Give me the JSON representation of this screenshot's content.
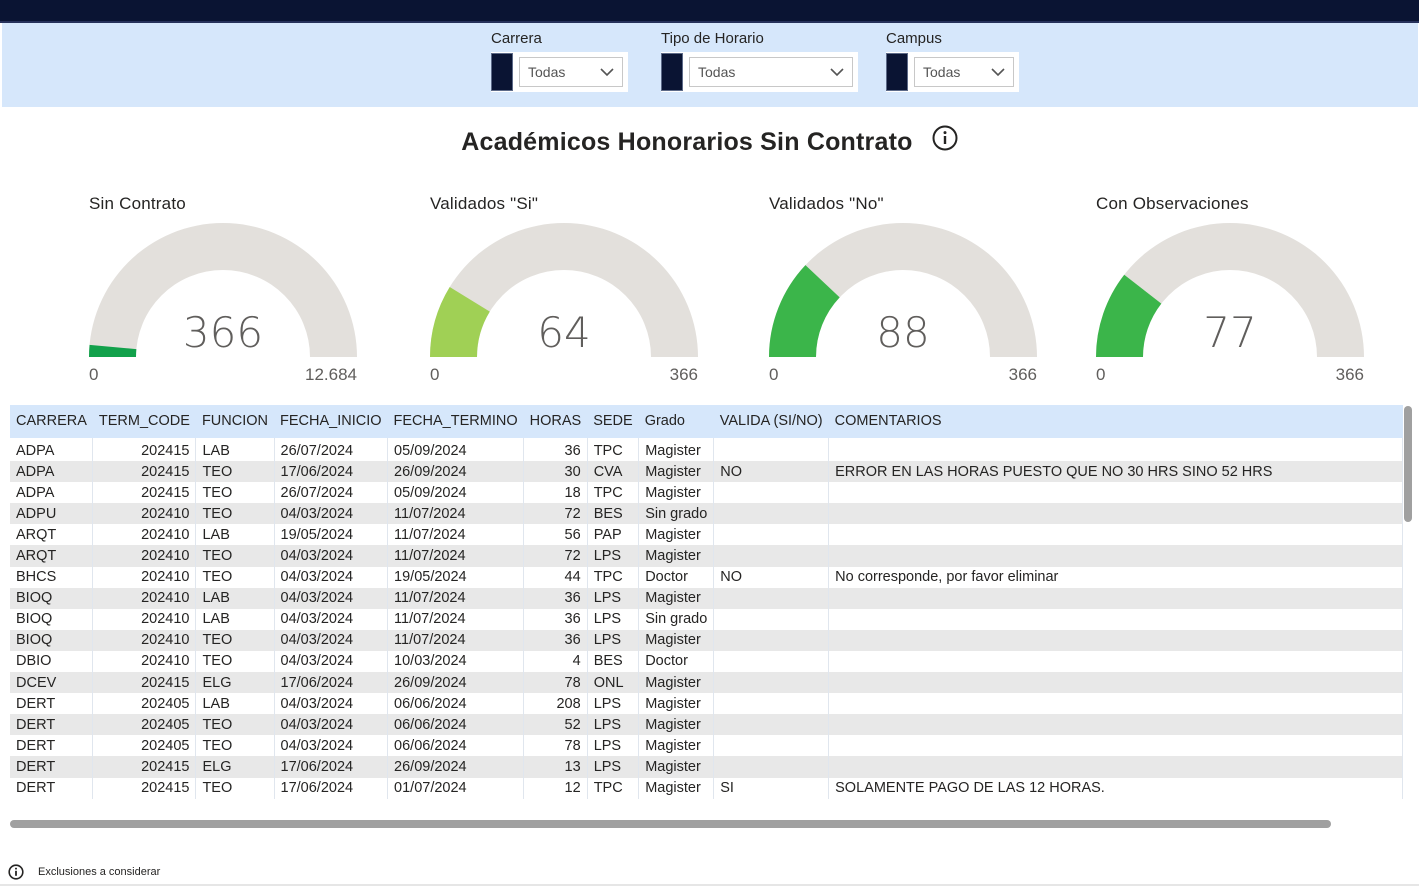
{
  "filters": [
    {
      "label": "Carrera",
      "value": "Todas"
    },
    {
      "label": "Tipo de Horario",
      "value": "Todas"
    },
    {
      "label": "Campus",
      "value": "Todas"
    }
  ],
  "title": "Académicos Honorarios Sin Contrato",
  "gauges": [
    {
      "title": "Sin Contrato",
      "value": "366",
      "min": "0",
      "max": "12.684",
      "fraction": 0.0289,
      "color": "#12a14b"
    },
    {
      "title": "Validados \"Si\"",
      "value": "64",
      "min": "0",
      "max": "366",
      "fraction": 0.1749,
      "color": "#a0d055"
    },
    {
      "title": "Validados \"No\"",
      "value": "88",
      "min": "0",
      "max": "366",
      "fraction": 0.2404,
      "color": "#3bb54a"
    },
    {
      "title": "Con Observaciones",
      "value": "77",
      "min": "0",
      "max": "366",
      "fraction": 0.2104,
      "color": "#3bb54a"
    }
  ],
  "table": {
    "columns": [
      "CARRERA",
      "TERM_CODE",
      "FUNCION",
      "FECHA_INICIO",
      "FECHA_TERMINO",
      "HORAS",
      "SEDE",
      "Grado",
      "VALIDA (SI/NO)",
      "COMENTARIOS"
    ],
    "rows": [
      [
        "ADPA",
        "202415",
        "LAB",
        "26/07/2024",
        "05/09/2024",
        "36",
        "TPC",
        "Magister",
        "",
        ""
      ],
      [
        "ADPA",
        "202415",
        "TEO",
        "17/06/2024",
        "26/09/2024",
        "30",
        "CVA",
        "Magister",
        "NO",
        "ERROR EN LAS HORAS PUESTO QUE NO 30 HRS SINO 52 HRS"
      ],
      [
        "ADPA",
        "202415",
        "TEO",
        "26/07/2024",
        "05/09/2024",
        "18",
        "TPC",
        "Magister",
        "",
        ""
      ],
      [
        "ADPU",
        "202410",
        "TEO",
        "04/03/2024",
        "11/07/2024",
        "72",
        "BES",
        "Sin grado",
        "",
        ""
      ],
      [
        "ARQT",
        "202410",
        "LAB",
        "19/05/2024",
        "11/07/2024",
        "56",
        "PAP",
        "Magister",
        "",
        ""
      ],
      [
        "ARQT",
        "202410",
        "TEO",
        "04/03/2024",
        "11/07/2024",
        "72",
        "LPS",
        "Magister",
        "",
        ""
      ],
      [
        "BHCS",
        "202410",
        "TEO",
        "04/03/2024",
        "19/05/2024",
        "44",
        "TPC",
        "Doctor",
        "NO",
        "No corresponde, por favor eliminar"
      ],
      [
        "BIOQ",
        "202410",
        "LAB",
        "04/03/2024",
        "11/07/2024",
        "36",
        "LPS",
        "Magister",
        "",
        ""
      ],
      [
        "BIOQ",
        "202410",
        "LAB",
        "04/03/2024",
        "11/07/2024",
        "36",
        "LPS",
        "Sin grado",
        "",
        ""
      ],
      [
        "BIOQ",
        "202410",
        "TEO",
        "04/03/2024",
        "11/07/2024",
        "36",
        "LPS",
        "Magister",
        "",
        ""
      ],
      [
        "DBIO",
        "202410",
        "TEO",
        "04/03/2024",
        "10/03/2024",
        "4",
        "BES",
        "Doctor",
        "",
        ""
      ],
      [
        "DCEV",
        "202415",
        "ELG",
        "17/06/2024",
        "26/09/2024",
        "78",
        "ONL",
        "Magister",
        "",
        ""
      ],
      [
        "DERT",
        "202405",
        "LAB",
        "04/03/2024",
        "06/06/2024",
        "208",
        "LPS",
        "Magister",
        "",
        ""
      ],
      [
        "DERT",
        "202405",
        "TEO",
        "04/03/2024",
        "06/06/2024",
        "52",
        "LPS",
        "Magister",
        "",
        ""
      ],
      [
        "DERT",
        "202405",
        "TEO",
        "04/03/2024",
        "06/06/2024",
        "78",
        "LPS",
        "Magister",
        "",
        ""
      ],
      [
        "DERT",
        "202415",
        "ELG",
        "17/06/2024",
        "26/09/2024",
        "13",
        "LPS",
        "Magister",
        "",
        ""
      ],
      [
        "DERT",
        "202415",
        "TEO",
        "17/06/2024",
        "01/07/2024",
        "12",
        "TPC",
        "Magister",
        "SI",
        "SOLAMENTE PAGO DE LAS 12 HORAS."
      ]
    ]
  },
  "footer": {
    "text": "Exclusiones a considerar"
  }
}
